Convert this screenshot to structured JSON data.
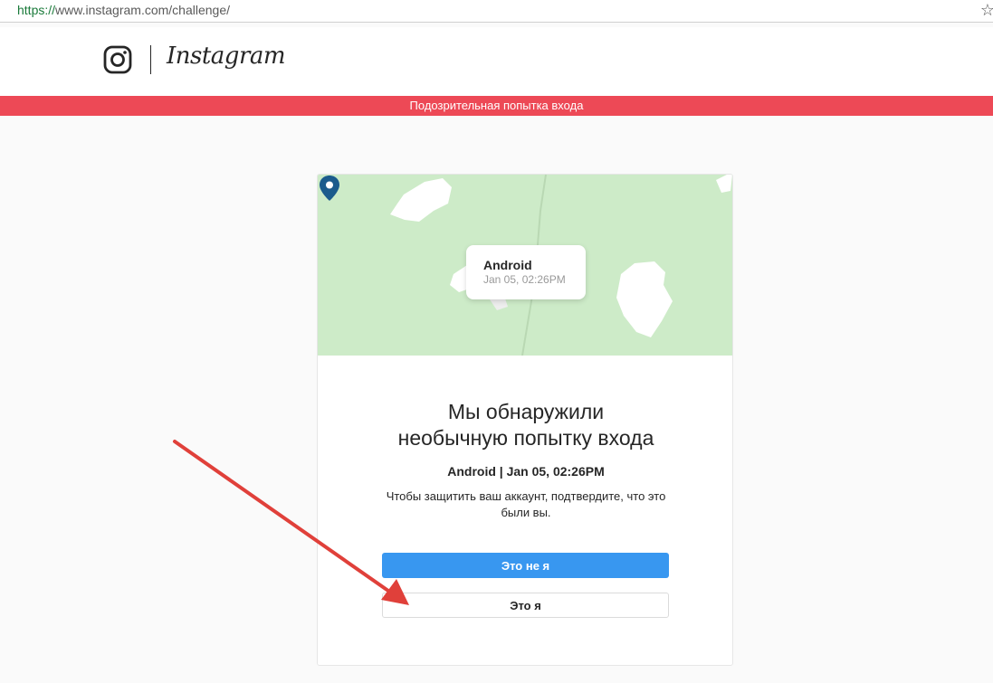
{
  "browser": {
    "url_scheme": "https://",
    "url_rest": "www.instagram.com/challenge/",
    "bookmark_icon": "star-icon"
  },
  "header": {
    "logo_icon": "instagram-camera-icon",
    "wordmark": "Instagram"
  },
  "banner": {
    "text": "Подозрительная попытка входа",
    "color": "#ed4956"
  },
  "card": {
    "map": {
      "background_color": "#cdebc8",
      "tooltip_title": "Android",
      "tooltip_subtitle": "Jan 05, 02:26PM",
      "pin_icon": "location-pin-icon",
      "pin_color": "#1b5b8c"
    },
    "title_line1": "Мы обнаружили",
    "title_line2": "необычную попытку входа",
    "device_line": "Android | Jan 05, 02:26PM",
    "description": "Чтобы защитить ваш аккаунт, подтвердите, что это были вы.",
    "not_me_button": "Это не я",
    "its_me_button": "Это я",
    "primary_color": "#3897f0"
  },
  "annotation": {
    "arrow_color": "#e0403a"
  }
}
